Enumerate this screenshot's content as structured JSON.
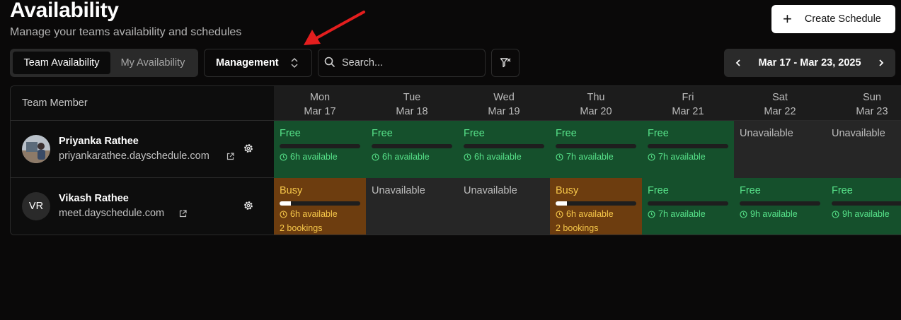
{
  "header": {
    "title": "Availability",
    "subtitle": "Manage your teams availability and schedules",
    "create_label": "Create Schedule"
  },
  "toolbar": {
    "tabs": [
      {
        "label": "Team Availability",
        "active": true
      },
      {
        "label": "My Availability",
        "active": false
      }
    ],
    "department": "Management",
    "search_placeholder": "Search...",
    "date_range": "Mar 17 - Mar 23, 2025"
  },
  "grid": {
    "member_header": "Team Member",
    "days": [
      {
        "dow": "Mon",
        "date": "Mar 17"
      },
      {
        "dow": "Tue",
        "date": "Mar 18"
      },
      {
        "dow": "Wed",
        "date": "Mar 19"
      },
      {
        "dow": "Thu",
        "date": "Mar 20"
      },
      {
        "dow": "Fri",
        "date": "Mar 21"
      },
      {
        "dow": "Sat",
        "date": "Mar 22"
      },
      {
        "dow": "Sun",
        "date": "Mar 23"
      }
    ],
    "members": [
      {
        "name": "Priyanka Rathee",
        "link": "priyankarathee.dayschedule.com",
        "avatar": "photo",
        "cells": [
          {
            "status": "Free",
            "hours": "6h available",
            "booked_fraction": 0
          },
          {
            "status": "Free",
            "hours": "6h available",
            "booked_fraction": 0
          },
          {
            "status": "Free",
            "hours": "6h available",
            "booked_fraction": 0
          },
          {
            "status": "Free",
            "hours": "7h available",
            "booked_fraction": 0
          },
          {
            "status": "Free",
            "hours": "7h available",
            "booked_fraction": 0
          },
          {
            "status": "Unavailable"
          },
          {
            "status": "Unavailable"
          }
        ]
      },
      {
        "name": "Vikash Rathee",
        "link": "meet.dayschedule.com",
        "avatar": "VR",
        "cells": [
          {
            "status": "Busy",
            "hours": "6h available",
            "bookings": "2 bookings",
            "booked_fraction": 0.14
          },
          {
            "status": "Unavailable"
          },
          {
            "status": "Unavailable"
          },
          {
            "status": "Busy",
            "hours": "6h available",
            "bookings": "2 bookings",
            "booked_fraction": 0.14
          },
          {
            "status": "Free",
            "hours": "7h available",
            "booked_fraction": 0
          },
          {
            "status": "Free",
            "hours": "9h available",
            "booked_fraction": 0
          },
          {
            "status": "Free",
            "hours": "9h available",
            "booked_fraction": 0
          }
        ]
      }
    ]
  },
  "colors": {
    "free_bg": "#15502c",
    "free_text": "#57e38a",
    "busy_bg": "#6d3d0f",
    "busy_text": "#f7c84a",
    "unavailable_bg": "#262626",
    "annotation_arrow": "#e41e1e"
  },
  "icons": [
    "plus-icon",
    "chevrons-up-down-icon",
    "search-icon",
    "filter-x-icon",
    "chevron-left-icon",
    "chevron-right-icon",
    "external-link-icon",
    "gear-icon",
    "clock-icon"
  ]
}
